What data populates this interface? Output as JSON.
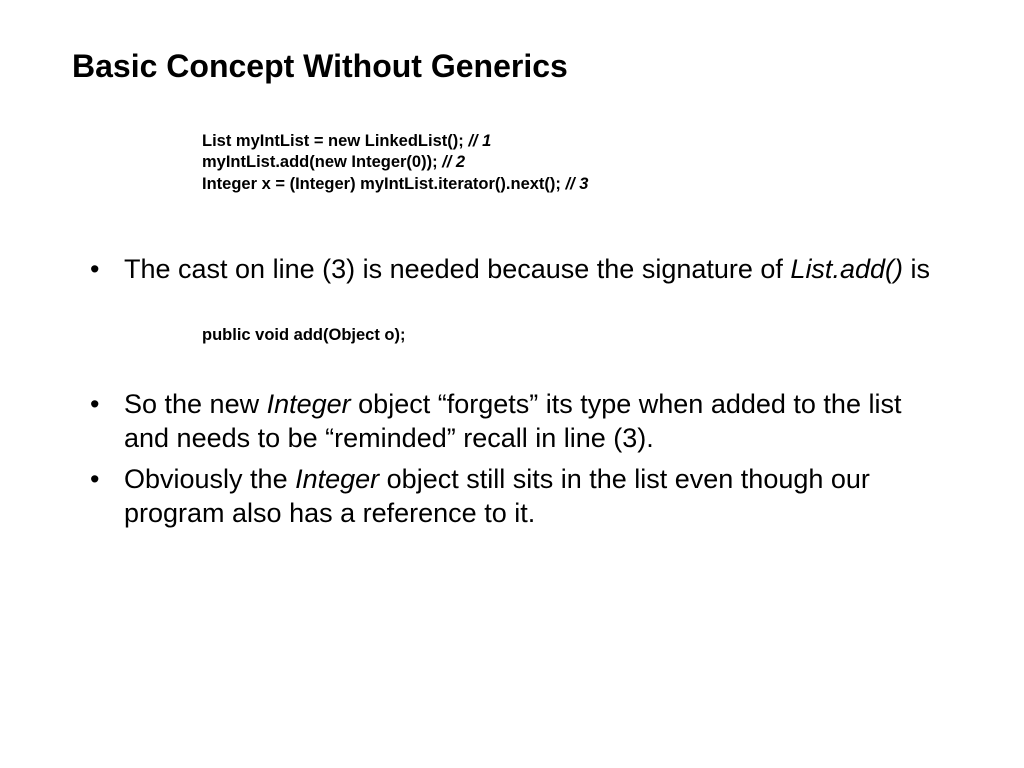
{
  "title": "Basic Concept Without Generics",
  "code": {
    "line1": "List myIntList = new LinkedList();",
    "c1": " // 1",
    "line2": "myIntList.add(new Integer(0));",
    "c2": " // 2",
    "line3": "Integer x = (Integer) myIntList.iterator().next();",
    "c3": " // 3"
  },
  "bullet1_a": "The cast on line (3) is needed because the signature of ",
  "bullet1_i": "List.add()",
  "bullet1_b": " is",
  "sig": "public void add(Object o);",
  "bullet2_a": "So the new ",
  "bullet2_i": "Integer",
  "bullet2_b": " object “forgets” its type when added to the list and needs to be “reminded” recall in line (3).",
  "bullet3_a": "Obviously the ",
  "bullet3_i": "Integer",
  "bullet3_b": " object still sits in the list even though our program also has a reference to it."
}
